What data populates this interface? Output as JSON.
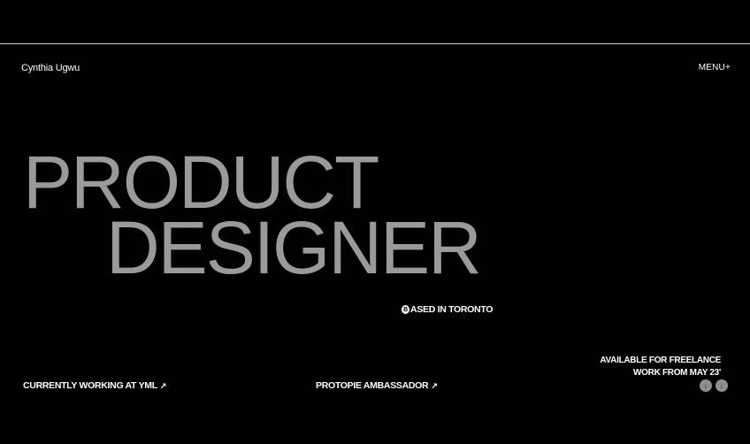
{
  "header": {
    "brand": "Cynthia Ugwu",
    "menu_label": "MENU+"
  },
  "hero": {
    "line1": "PRODUCT",
    "line2": "DESIGNER"
  },
  "location": {
    "glyph": "B",
    "text": "ASED IN TORONTO"
  },
  "footer": {
    "yml_label": "CURRENTLY WORKING AT YML",
    "protopie_label": "PROTOPIE AMBASSADOR",
    "arrow": "↗",
    "availability_line1": "AVAILABLE FOR FREELANCE",
    "availability_line2": "WORK FROM MAY 23'",
    "scroll_arrow": "↓"
  },
  "colors": {
    "background": "#000000",
    "hero_text": "#9a9a9a",
    "text": "#ffffff"
  }
}
